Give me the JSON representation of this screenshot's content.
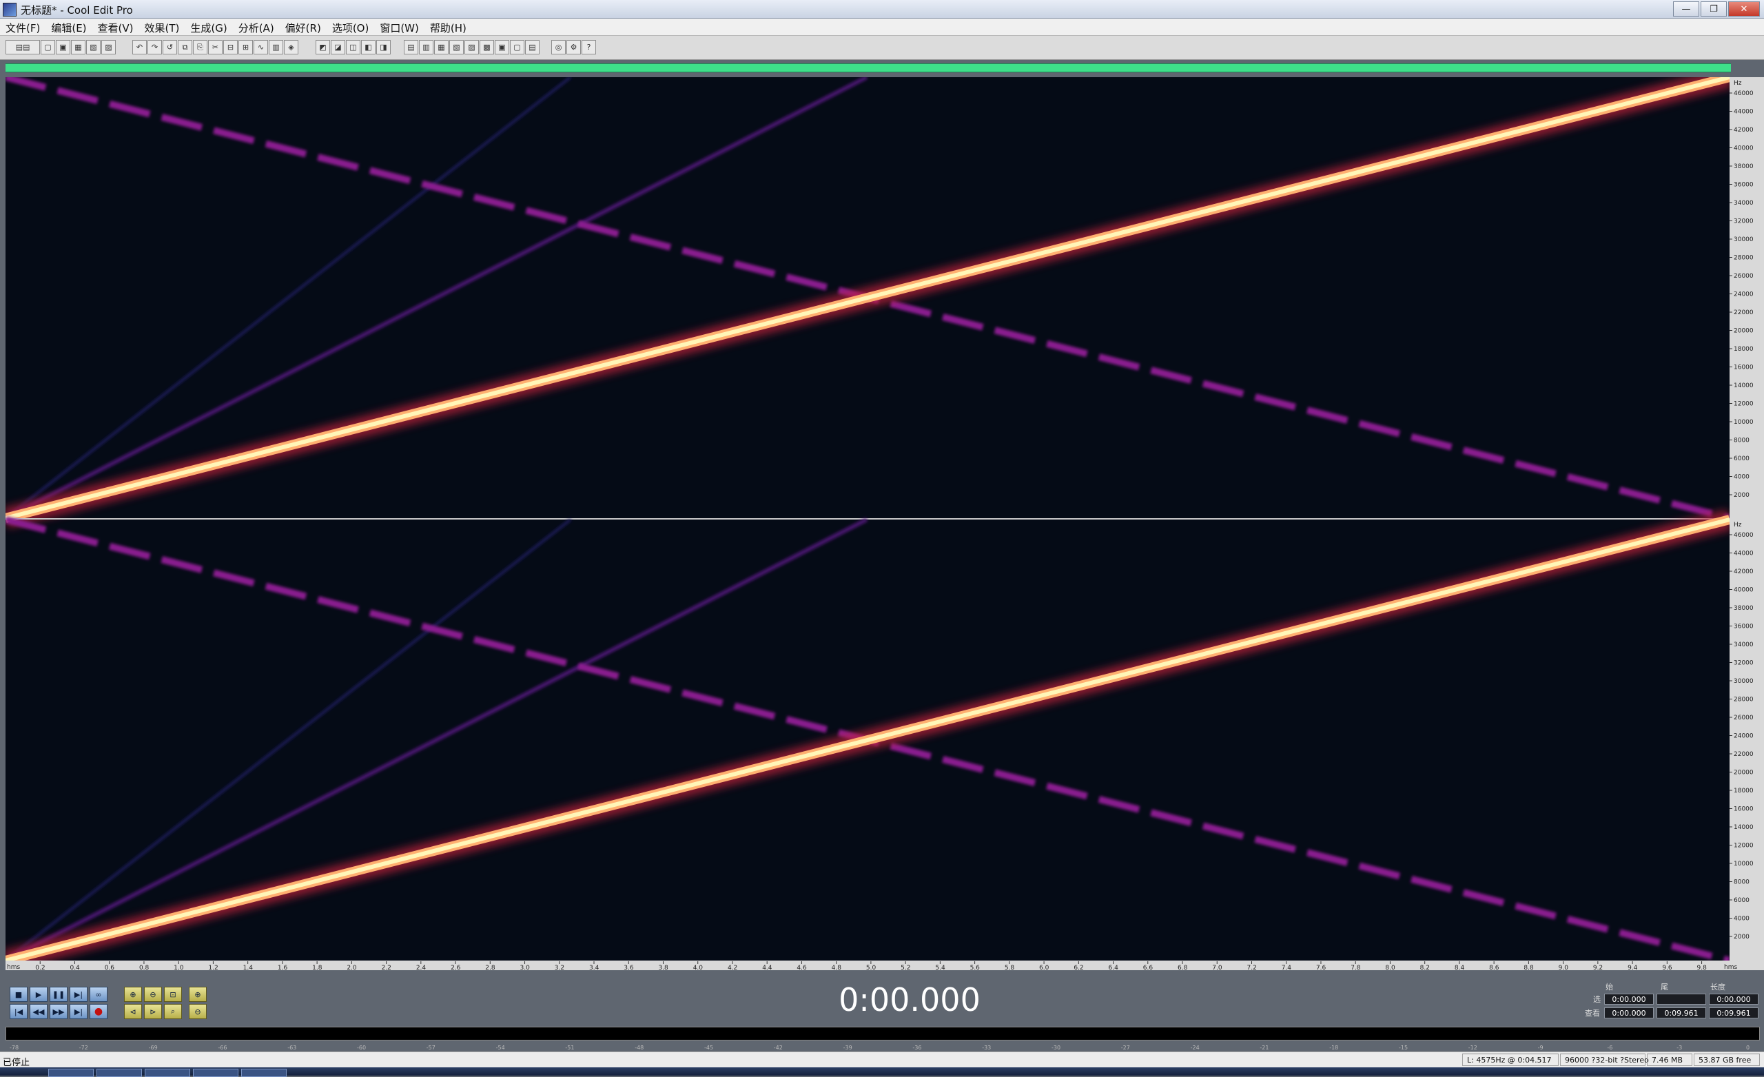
{
  "window": {
    "title": "无标题* - Cool Edit Pro",
    "minimize_glyph": "—",
    "maximize_glyph": "❐",
    "close_glyph": "✕"
  },
  "menu": [
    "文件(F)",
    "编辑(E)",
    "查看(V)",
    "效果(T)",
    "生成(G)",
    "分析(A)",
    "偏好(R)",
    "选项(O)",
    "窗口(W)",
    "帮助(H)"
  ],
  "frequency_axis": {
    "unit": "Hz",
    "ticks": [
      "46000",
      "44000",
      "42000",
      "40000",
      "38000",
      "36000",
      "34000",
      "32000",
      "30000",
      "28000",
      "26000",
      "24000",
      "22000",
      "20000",
      "18000",
      "16000",
      "14000",
      "12000",
      "10000",
      "8000",
      "6000",
      "4000",
      "2000"
    ]
  },
  "time_axis": {
    "unit_left": "hms",
    "unit_right": "hms",
    "ticks": [
      "0.2",
      "0.4",
      "0.6",
      "0.8",
      "1.0",
      "1.2",
      "1.4",
      "1.6",
      "1.8",
      "2.0",
      "2.2",
      "2.4",
      "2.6",
      "2.8",
      "3.0",
      "3.2",
      "3.4",
      "3.6",
      "3.8",
      "4.0",
      "4.2",
      "4.4",
      "4.6",
      "4.8",
      "5.0",
      "5.2",
      "5.4",
      "5.6",
      "5.8",
      "6.0",
      "6.2",
      "6.4",
      "6.6",
      "6.8",
      "7.0",
      "7.2",
      "7.4",
      "7.6",
      "7.8",
      "8.0",
      "8.2",
      "8.4",
      "8.6",
      "8.8",
      "9.0",
      "9.2",
      "9.4",
      "9.6",
      "9.8"
    ]
  },
  "transport": {
    "time_display": "0:00.000"
  },
  "selection_panel": {
    "header_begin": "始",
    "header_end": "尾",
    "header_length": "长度",
    "row_selection": "选",
    "row_view": "查看",
    "sel_begin": "0:00.000",
    "sel_end": "",
    "sel_length": "0:00.000",
    "view_begin": "0:00.000",
    "view_end": "0:09.961",
    "view_length": "0:09.961"
  },
  "level_meter": {
    "ticks": [
      "-78",
      "-72",
      "-69",
      "-66",
      "-63",
      "-60",
      "-57",
      "-54",
      "-51",
      "-48",
      "-45",
      "-42",
      "-39",
      "-36",
      "-33",
      "-30",
      "-27",
      "-24",
      "-21",
      "-18",
      "-15",
      "-12",
      "-9",
      "-6",
      "-3",
      "0"
    ]
  },
  "status": {
    "state": "已停止",
    "cursor": "L: 4575Hz @  0:04.517",
    "format": "96000 ?32-bit ?Stereo",
    "file_size": "7.46 MB",
    "free_space": "53.87 GB free"
  },
  "colors": {
    "spectrogram_bg": "#050b16",
    "sweep_main": "#fff6b8",
    "sweep_purple": "#8a1f8f",
    "overview": "#3ee08a"
  }
}
